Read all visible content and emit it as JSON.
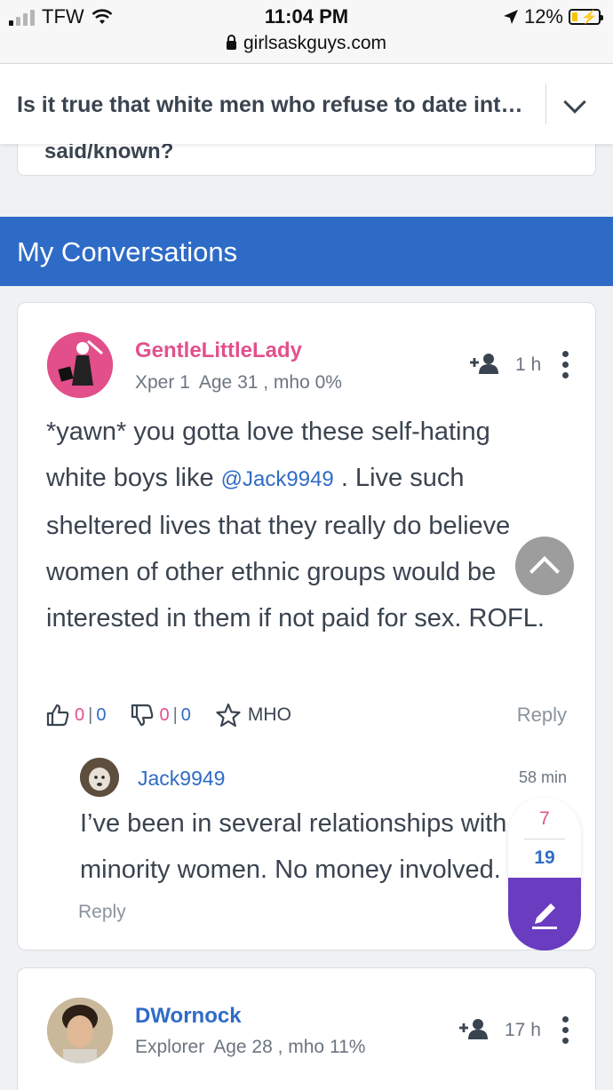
{
  "status_bar": {
    "carrier": "TFW",
    "time": "11:04 PM",
    "url": "girlsaskguys.com",
    "battery": "12%"
  },
  "question": {
    "title": "Is it true that white men who refuse to date interracially are just racist and don't want to say so out loud?"
  },
  "prev_card": {
    "cut_text": "said/known?"
  },
  "section": {
    "title": "My Conversations"
  },
  "comment": {
    "username": "GentleLittleLady",
    "level": "Xper 1",
    "meta": "Age 31 , mho 0%",
    "time": "1 h",
    "text_before": "*yawn* you gotta love these self-hating white boys like ",
    "mention": "@Jack9949",
    "text_after": " . Live such sheltered lives that they really do believe women of other ethnic groups would be interested in them if not paid for sex. ROFL.",
    "up_pink": "0",
    "up_sep": "|",
    "up_blue": "0",
    "down_pink": "0",
    "down_sep": "|",
    "down_blue": "0",
    "mho_label": "MHO",
    "reply_label": "Reply"
  },
  "sub_reply": {
    "username": "Jack9949",
    "time": "58 min",
    "text_line1": "I’ve been in several relationships with",
    "text_line2": "minority women. No money involved.",
    "reply_label": "Reply"
  },
  "comment2": {
    "username": "DWornock",
    "level": "Explorer",
    "meta": "Age 28 , mho 11%",
    "time": "17 h"
  },
  "compose": {
    "count_pink": "7",
    "count_blue": "19"
  },
  "colors": {
    "brand_blue": "#2e6bc6",
    "pink": "#e2518c",
    "purple": "#6a3cc0",
    "text": "#3a4450"
  }
}
